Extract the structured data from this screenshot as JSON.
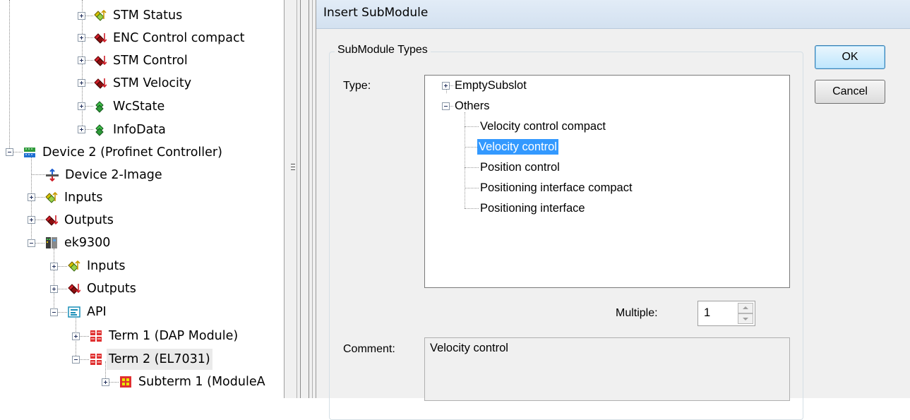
{
  "tree": {
    "items": [
      {
        "label": "STM Status",
        "icon": "input-icon"
      },
      {
        "label": "ENC Control compact",
        "icon": "output-icon"
      },
      {
        "label": "STM Control",
        "icon": "output-icon"
      },
      {
        "label": "STM Velocity",
        "icon": "output-icon"
      },
      {
        "label": "WcState",
        "icon": "green-state-icon"
      },
      {
        "label": "InfoData",
        "icon": "green-state-icon"
      },
      {
        "label": "Device 2 (Profinet Controller)",
        "icon": "profinet-device-icon"
      },
      {
        "label": "Device 2-Image",
        "icon": "image-icon"
      },
      {
        "label": "Inputs",
        "icon": "input-icon"
      },
      {
        "label": "Outputs",
        "icon": "output-icon"
      },
      {
        "label": "ek9300",
        "icon": "coupler-icon"
      },
      {
        "label": "Inputs",
        "icon": "input-icon"
      },
      {
        "label": "Outputs",
        "icon": "output-icon"
      },
      {
        "label": "API",
        "icon": "api-icon"
      },
      {
        "label": "Term 1 (DAP Module)",
        "icon": "terminal-icon"
      },
      {
        "label": "Term 2 (EL7031)",
        "icon": "terminal-icon"
      },
      {
        "label": "Subterm 1 (ModuleA",
        "icon": "subterminal-icon"
      }
    ]
  },
  "dialog": {
    "title": "Insert SubModule",
    "group_title": "SubModule Types",
    "type_label": "Type:",
    "type_tree": [
      {
        "label": "EmptySubslot"
      },
      {
        "label": "Others"
      },
      {
        "label": "Velocity control compact"
      },
      {
        "label": "Velocity control",
        "selected": true
      },
      {
        "label": "Position control"
      },
      {
        "label": "Positioning interface compact"
      },
      {
        "label": "Positioning interface"
      }
    ],
    "multiple_label": "Multiple:",
    "multiple_value": "1",
    "comment_label": "Comment:",
    "comment_value": "Velocity control",
    "ok_label": "OK",
    "cancel_label": "Cancel"
  },
  "colors": {
    "selection": "#3399ff",
    "title_bar": "#dbe6f3",
    "output_icon": "#c8102e",
    "input_icon": "#c8b400",
    "state_icon": "#2e9b3a"
  }
}
